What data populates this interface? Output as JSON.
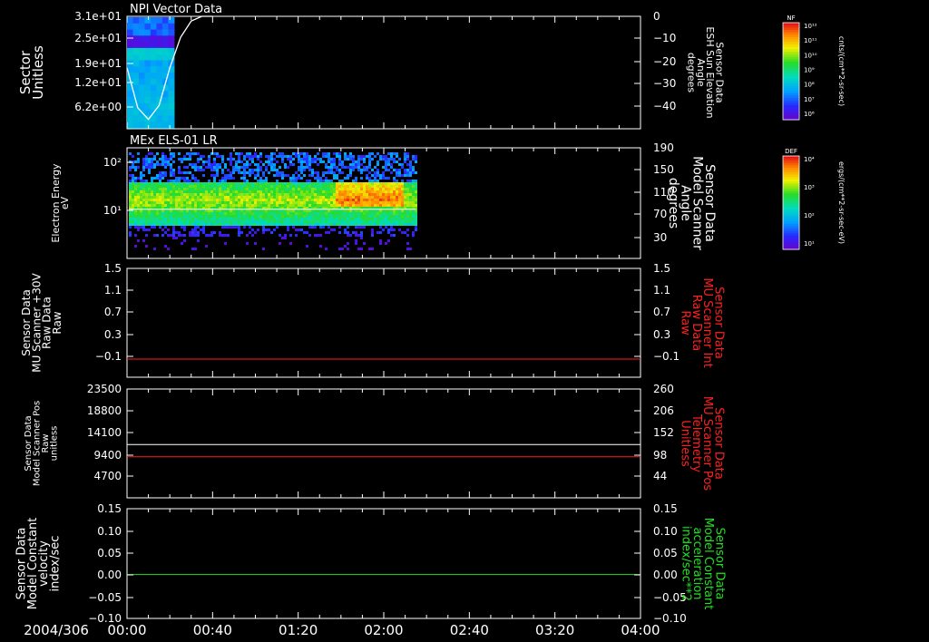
{
  "date_label": "2004/306",
  "time_ticks": [
    "00:00",
    "00:40",
    "01:20",
    "02:00",
    "02:40",
    "03:20",
    "04:00"
  ],
  "panels": [
    {
      "title": "NPI Vector Data",
      "left_label": [
        "Sector",
        "Unitless"
      ],
      "right_label": [
        "Sensor Data",
        "ESH Sun Elevation",
        "Angle",
        "degrees"
      ],
      "right_label_color": "#ffffff",
      "left_ticks": [
        "3.1e+01",
        "2.5e+01",
        "1.9e+01",
        "1.2e+01",
        "6.2e+00"
      ],
      "right_ticks": [
        "0",
        "−10",
        "−20",
        "−30",
        "−40"
      ],
      "colorbar": {
        "top_label": "NF",
        "unit": "cnts/(cm**2-sr-sec)",
        "ticks": [
          "10¹²",
          "10¹¹",
          "10¹⁰",
          "10⁹",
          "10⁸",
          "10⁷",
          "10⁶"
        ]
      }
    },
    {
      "title": "MEx ELS-01 LR",
      "left_label": [
        "Electron Energy",
        "eV"
      ],
      "right_label": [
        "Sensor Data",
        "Model Scanner",
        "Angle",
        "degrees"
      ],
      "right_label_color": "#ffffff",
      "left_ticks": [
        "10²",
        "10¹"
      ],
      "right_ticks": [
        "190",
        "150",
        "110",
        "70",
        "30"
      ],
      "colorbar": {
        "top_label": "DEF",
        "unit": "ergs/(cm**2-sr-sec-eV)",
        "ticks": [
          "10⁴",
          "10³",
          "10²",
          "10¹"
        ]
      }
    },
    {
      "title": "",
      "left_label": [
        "Sensor Data",
        "MU Scanner +30V",
        "Raw Data",
        "Raw"
      ],
      "right_label": [
        "Sensor Data",
        "MU Scanner Int",
        "Raw Data",
        "Raw"
      ],
      "right_label_color": "#ff2020",
      "left_ticks": [
        "1.5",
        "1.1",
        "0.7",
        "0.3",
        "−0.1"
      ],
      "right_ticks": [
        "1.5",
        "1.1",
        "0.7",
        "0.3",
        "−0.1"
      ]
    },
    {
      "title": "",
      "left_label": [
        "Sensor Data",
        "Model Scanner Pos",
        "Raw",
        "unitless"
      ],
      "right_label": [
        "Sensor Data",
        "MU Scanner Pos",
        "Telemetry",
        "Unitless"
      ],
      "right_label_color": "#ff2020",
      "left_ticks": [
        "23500",
        "18800",
        "14100",
        "9400",
        "4700"
      ],
      "right_ticks": [
        "260",
        "206",
        "152",
        "98",
        "44"
      ]
    },
    {
      "title": "",
      "left_label": [
        "Sensor Data",
        "Model Constant",
        "velocity",
        "index/sec"
      ],
      "right_label": [
        "Sensor Data",
        "Model Constant",
        "acceleration",
        "index/sec**2"
      ],
      "right_label_color": "#20e020",
      "left_ticks": [
        "0.15",
        "0.10",
        "0.05",
        "0.00",
        "−0.05",
        "−0.10"
      ],
      "right_ticks": [
        "0.15",
        "0.10",
        "0.05",
        "0.00",
        "−0.05",
        "−0.10"
      ]
    }
  ],
  "chart_data": [
    {
      "type": "heatmap",
      "title": "NPI Vector Data",
      "x_range": [
        "00:00",
        "04:00"
      ],
      "data_extent": [
        "00:00",
        "00:22"
      ],
      "ylabel": "Sector Unitless",
      "y_range": [
        0,
        31
      ],
      "overlay_line": {
        "name": "ESH Sun Elevation Angle (degrees)",
        "x": [
          "00:00",
          "00:05",
          "00:10",
          "00:15",
          "00:20",
          "00:25",
          "00:30",
          "00:35",
          "00:40"
        ],
        "y": [
          -22,
          -39,
          -44,
          -38,
          -22,
          -9,
          -2,
          0,
          0
        ]
      }
    },
    {
      "type": "heatmap",
      "title": "MEx ELS-01 LR",
      "x_range": [
        "00:00",
        "04:00"
      ],
      "data_extent": [
        "00:00",
        "02:15"
      ],
      "ylabel": "Electron Energy eV",
      "y_scale": "log",
      "overlay_line": {
        "name": "Model Scanner Angle (degrees)",
        "y": 90
      }
    },
    {
      "type": "line",
      "x_range": [
        "00:00",
        "04:00"
      ],
      "ylim": [
        -0.3,
        1.5
      ],
      "series": [
        {
          "name": "MU Scanner Int Raw Data",
          "color": "#ff2020",
          "y": 0.0
        }
      ]
    },
    {
      "type": "line",
      "x_range": [
        "00:00",
        "04:00"
      ],
      "ylim_left": [
        0,
        23500
      ],
      "ylim_right": [
        0,
        260
      ],
      "series": [
        {
          "name": "Model Scanner Pos Raw",
          "color": "#ffffff",
          "axis": "left",
          "y": 11500
        },
        {
          "name": "MU Scanner Pos Telemetry",
          "color": "#ff2020",
          "axis": "right",
          "y": 98
        }
      ]
    },
    {
      "type": "line",
      "x_range": [
        "00:00",
        "04:00"
      ],
      "ylim": [
        -0.1,
        0.15
      ],
      "series": [
        {
          "name": "Model Constant acceleration",
          "color": "#20e020",
          "y": 0.0
        }
      ]
    }
  ]
}
